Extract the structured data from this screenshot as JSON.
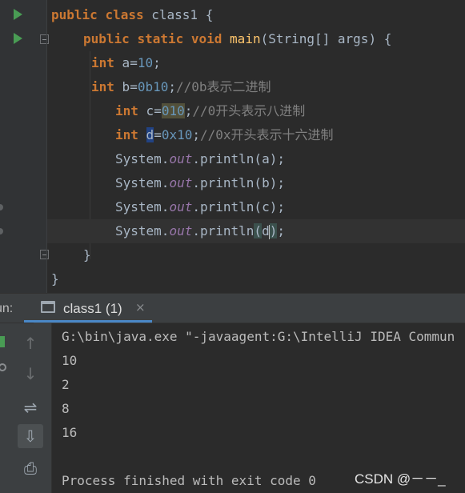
{
  "editor": {
    "tokens": {
      "public": "public",
      "class": "class",
      "static": "static",
      "void": "void",
      "int": "int",
      "class_name": "class1",
      "main": "main",
      "main_params": "(String[] args) {",
      "open_brace": "{",
      "close_brace": "}",
      "var_a": "a",
      "var_b": "b",
      "var_c": "c",
      "var_d": "d",
      "eq": "=",
      "val_a": "10",
      "val_b": "0b10",
      "val_c": "010",
      "val_d": "0x10",
      "semi": ";",
      "comment_b": "//0b表示二进制",
      "comment_c": "//0开头表示八进制",
      "comment_d": "//0x开头表示十六进制",
      "system": "System",
      "dot": ".",
      "out": "out",
      "println": "println",
      "paren_open": "(",
      "paren_close": ")",
      "arg_a": "a",
      "arg_b": "b",
      "arg_c": "c",
      "arg_d": "d",
      "end": ");"
    }
  },
  "run_window": {
    "label": "un:",
    "tab_label": "class1 (1)",
    "close_glyph": "×",
    "toolbar": {
      "up_arrow": "↑",
      "down_arrow": "↓",
      "wrap": "⇌",
      "scroll_end": "⇩",
      "print": "⎙",
      "delete": "🗑"
    },
    "console": {
      "command": "G:\\bin\\java.exe \"-javaagent:G:\\IntelliJ IDEA Commun",
      "outputs": [
        "10",
        "2",
        "8",
        "16"
      ],
      "finished": "Process finished with exit code 0"
    }
  },
  "watermark": "CSDN @－－_"
}
